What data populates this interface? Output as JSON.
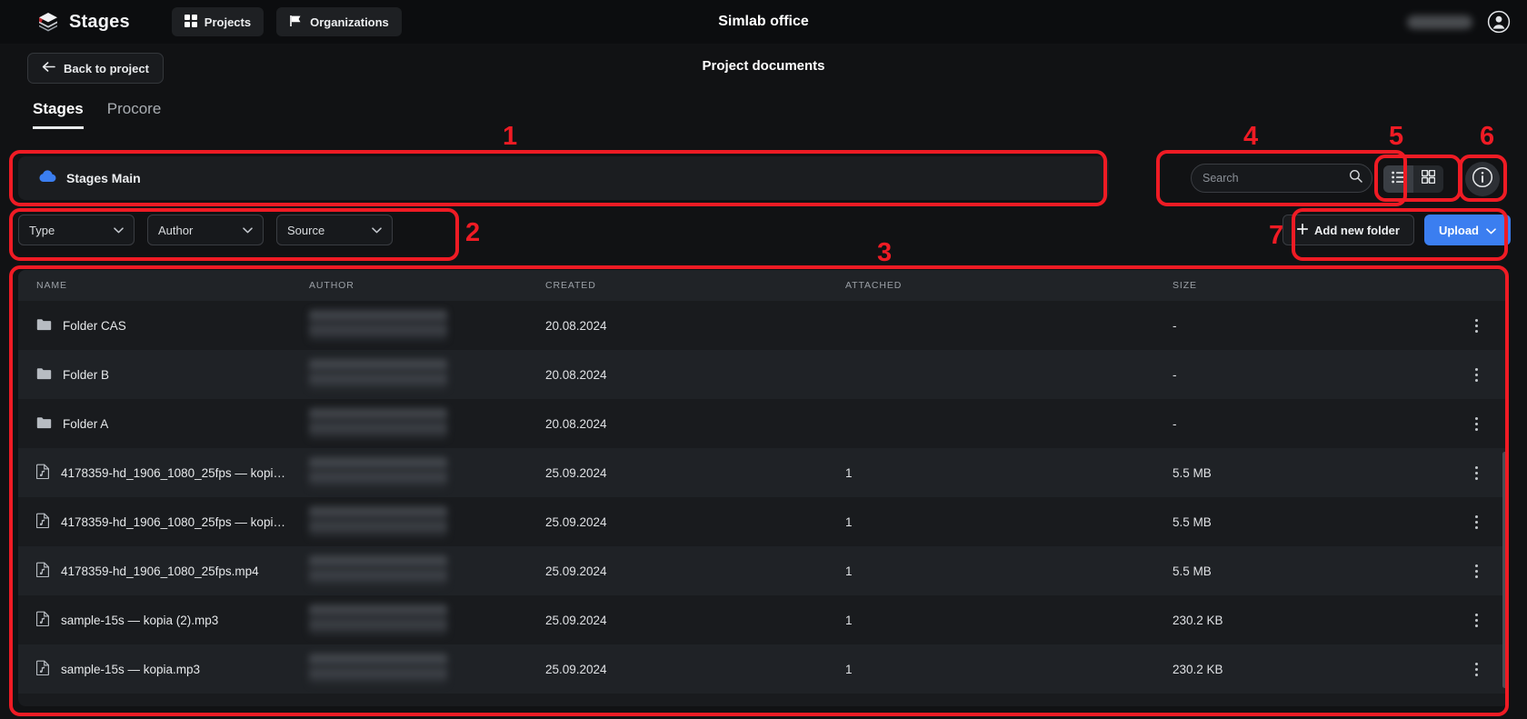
{
  "topbar": {
    "brand": "Stages",
    "projects_label": "Projects",
    "organizations_label": "Organizations",
    "title": "Simlab office",
    "account_icon": "account-circle-icon",
    "username_redacted": ""
  },
  "subheader": {
    "back_label": "Back to project",
    "page_title": "Project documents"
  },
  "tabs": [
    {
      "label": "Stages",
      "active": true
    },
    {
      "label": "Procore",
      "active": false
    }
  ],
  "breadcrumb": {
    "icon": "cloud-icon",
    "label": "Stages Main",
    "icon_color": "#3b7ef0"
  },
  "search": {
    "placeholder": "Search",
    "value": "",
    "icon": "search-icon"
  },
  "view_toggle": {
    "list_icon": "list-view-icon",
    "grid_icon": "grid-view-icon",
    "active": "list"
  },
  "info_button": {
    "icon": "info-icon"
  },
  "filters": [
    {
      "label": "Type"
    },
    {
      "label": "Author"
    },
    {
      "label": "Source"
    }
  ],
  "actions": {
    "add_folder_label": "Add new folder",
    "add_folder_icon": "plus-icon",
    "upload_label": "Upload",
    "upload_icon": "chevron-down-icon",
    "upload_color": "#3b7ef0"
  },
  "table": {
    "columns": [
      "NAME",
      "AUTHOR",
      "CREATED",
      "ATTACHED",
      "SIZE"
    ],
    "rows": [
      {
        "icon": "folder-icon",
        "name": "Folder CAS",
        "author": "",
        "created": "20.08.2024",
        "attached": "",
        "size": "-"
      },
      {
        "icon": "folder-icon",
        "name": "Folder B",
        "author": "",
        "created": "20.08.2024",
        "attached": "",
        "size": "-"
      },
      {
        "icon": "folder-icon",
        "name": "Folder A",
        "author": "",
        "created": "20.08.2024",
        "attached": "",
        "size": "-"
      },
      {
        "icon": "media-file-icon",
        "name": "4178359-hd_1906_1080_25fps — kopi…",
        "author": "",
        "created": "25.09.2024",
        "attached": "1",
        "size": "5.5 MB"
      },
      {
        "icon": "media-file-icon",
        "name": "4178359-hd_1906_1080_25fps — kopi…",
        "author": "",
        "created": "25.09.2024",
        "attached": "1",
        "size": "5.5 MB"
      },
      {
        "icon": "media-file-icon",
        "name": "4178359-hd_1906_1080_25fps.mp4",
        "author": "",
        "created": "25.09.2024",
        "attached": "1",
        "size": "5.5 MB"
      },
      {
        "icon": "media-file-icon",
        "name": "sample-15s — kopia (2).mp3",
        "author": "",
        "created": "25.09.2024",
        "attached": "1",
        "size": "230.2 KB"
      },
      {
        "icon": "media-file-icon",
        "name": "sample-15s — kopia.mp3",
        "author": "",
        "created": "25.09.2024",
        "attached": "1",
        "size": "230.2 KB"
      }
    ],
    "row_menu_icon": "kebab-menu-icon"
  },
  "annotations": [
    {
      "number": "1"
    },
    {
      "number": "2"
    },
    {
      "number": "3"
    },
    {
      "number": "4"
    },
    {
      "number": "5"
    },
    {
      "number": "6"
    },
    {
      "number": "7"
    }
  ],
  "accent": "#ef1b24"
}
